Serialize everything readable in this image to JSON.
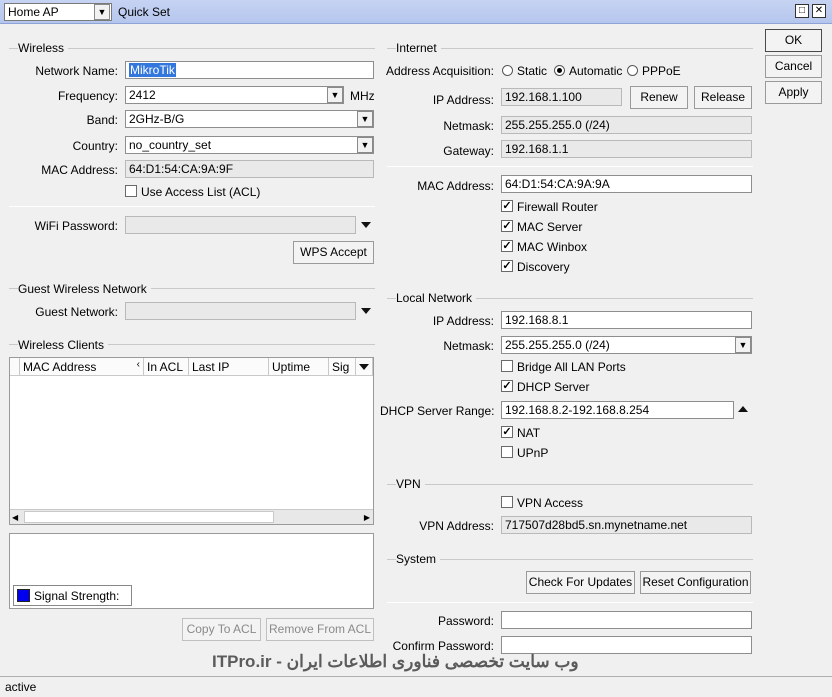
{
  "titlebar": {
    "mode": "Home AP",
    "title": "Quick Set"
  },
  "actions": {
    "ok": "OK",
    "cancel": "Cancel",
    "apply": "Apply"
  },
  "wireless": {
    "title": "Wireless",
    "network_name_label": "Network Name:",
    "network_name": "MikroTik",
    "frequency_label": "Frequency:",
    "frequency": "2412",
    "frequency_unit": "MHz",
    "band_label": "Band:",
    "band": "2GHz-B/G",
    "country_label": "Country:",
    "country": "no_country_set",
    "mac_label": "MAC Address:",
    "mac": "64:D1:54:CA:9A:9F",
    "access_list_label": "Use Access List (ACL)",
    "wifi_password_label": "WiFi Password:",
    "wps_accept": "WPS Accept"
  },
  "guest": {
    "title": "Guest Wireless Network",
    "network_label": "Guest Network:"
  },
  "clients": {
    "title": "Wireless Clients",
    "columns": [
      "MAC Address",
      "In ACL",
      "Last IP",
      "Uptime",
      "Sig"
    ],
    "signal_legend": "Signal Strength:",
    "copy_to_acl": "Copy To ACL",
    "remove_from_acl": "Remove From ACL"
  },
  "internet": {
    "title": "Internet",
    "acq_label": "Address Acquisition:",
    "acq_options": [
      "Static",
      "Automatic",
      "PPPoE"
    ],
    "acq_selected": "Automatic",
    "ip_label": "IP Address:",
    "ip": "192.168.1.100",
    "renew": "Renew",
    "release": "Release",
    "netmask_label": "Netmask:",
    "netmask": "255.255.255.0 (/24)",
    "gateway_label": "Gateway:",
    "gateway": "192.168.1.1",
    "mac_label": "MAC Address:",
    "mac": "64:D1:54:CA:9A:9A",
    "firewall_router": "Firewall Router",
    "mac_server": "MAC Server",
    "mac_winbox": "MAC Winbox",
    "discovery": "Discovery"
  },
  "local": {
    "title": "Local Network",
    "ip_label": "IP Address:",
    "ip": "192.168.8.1",
    "netmask_label": "Netmask:",
    "netmask": "255.255.255.0 (/24)",
    "bridge_all": "Bridge All LAN Ports",
    "dhcp_server": "DHCP Server",
    "dhcp_range_label": "DHCP Server Range:",
    "dhcp_range": "192.168.8.2-192.168.8.254",
    "nat": "NAT",
    "upnp": "UPnP"
  },
  "vpn": {
    "title": "VPN",
    "vpn_access": "VPN Access",
    "address_label": "VPN Address:",
    "address": "717507d28bd5.sn.mynetname.net"
  },
  "system": {
    "title": "System",
    "check_updates": "Check For Updates",
    "reset_config": "Reset Configuration",
    "password_label": "Password:",
    "confirm_password_label": "Confirm Password:"
  },
  "status": {
    "text": "active"
  },
  "watermark": "ITPro.ir - وب سایت تخصصی فناوری اطلاعات ایران",
  "colors": {
    "signal_swatch": "#0000ee",
    "titlebar": "#bfcdf0",
    "selection": "#3377dd"
  }
}
